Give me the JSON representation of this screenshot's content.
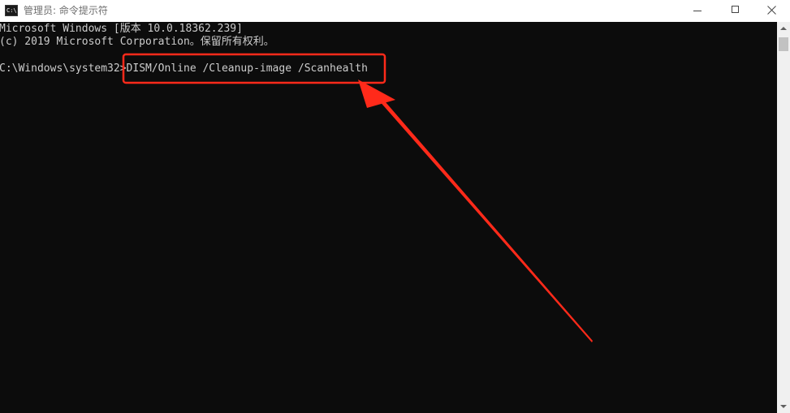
{
  "window": {
    "title": "管理员: 命令提示符",
    "icon": "cmd-icon",
    "icon_text": "C:\\"
  },
  "controls": {
    "minimize": "minimize-icon",
    "maximize": "maximize-icon",
    "close": "close-icon"
  },
  "console": {
    "lines": [
      "Microsoft Windows [版本 10.0.18362.239]",
      "(c) 2019 Microsoft Corporation。保留所有权利。"
    ],
    "prompt": "C:\\Windows\\system32>",
    "command": "DISM/Online /Cleanup-image /Scanhealth"
  },
  "colors": {
    "console_bg": "#0c0c0c",
    "console_text": "#cccccc",
    "highlight": "#ff2a1a"
  }
}
